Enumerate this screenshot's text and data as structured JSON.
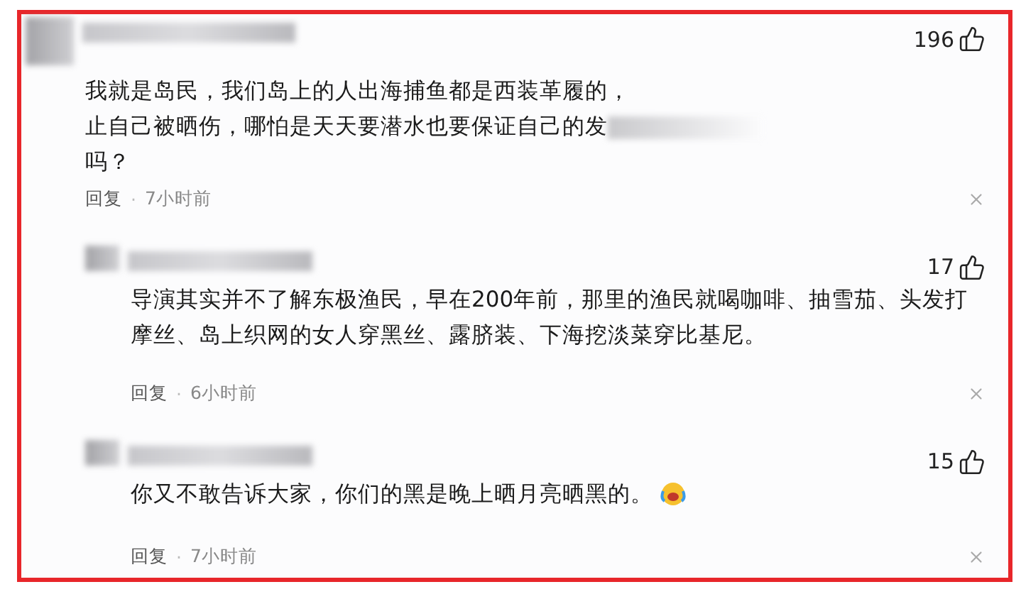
{
  "comments": [
    {
      "kind": "comment",
      "likes": "196",
      "lines": [
        "我就是岛民，我们岛上的人出海捕鱼都是西装革履的，",
        "止自己被晒伤，哪怕是天天要潜水也要保证自己的发",
        "吗？"
      ],
      "blurred_tail": true,
      "emoji": false,
      "reply_label": "回复",
      "separator": "·",
      "time": "7小时前"
    },
    {
      "kind": "reply",
      "likes": "17",
      "lines": [
        "导演其实并不了解东极渔民，早在200年前，那里的渔民就喝咖啡、抽雪茄、头发打",
        "摩丝、岛上织网的女人穿黑丝、露脐装、下海挖淡菜穿比基尼。"
      ],
      "blurred_tail": false,
      "emoji": false,
      "reply_label": "回复",
      "separator": "·",
      "time": "6小时前"
    },
    {
      "kind": "reply",
      "likes": "15",
      "lines": [
        "你又不敢告诉大家，你们的黑是晚上晒月亮晒黑的。"
      ],
      "blurred_tail": false,
      "emoji": true,
      "reply_label": "回复",
      "separator": "·",
      "time": "7小时前"
    }
  ]
}
